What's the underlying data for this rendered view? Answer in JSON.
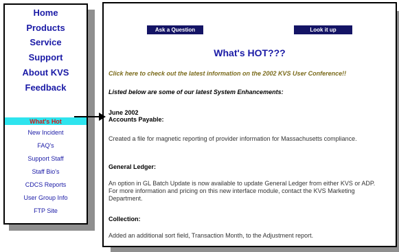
{
  "sidebar": {
    "main_items": [
      {
        "label": "Home"
      },
      {
        "label": "Products"
      },
      {
        "label": "Service"
      },
      {
        "label": "Support"
      },
      {
        "label": "About KVS"
      },
      {
        "label": "Feedback"
      }
    ],
    "sub_items": [
      {
        "label": "What's Hot"
      },
      {
        "label": "New Incident"
      },
      {
        "label": "FAQ's"
      },
      {
        "label": "Support Staff"
      },
      {
        "label": "Staff Bio's"
      },
      {
        "label": "CDCS Reports"
      },
      {
        "label": "User Group Info"
      },
      {
        "label": "FTP Site"
      }
    ]
  },
  "toolbar": {
    "ask_label": "Ask a Question",
    "lookup_label": "Look it up"
  },
  "content": {
    "title": "What's HOT???",
    "conference_link": "Click here to check out the latest information on the 2002 KVS User Conference!!",
    "intro": "Listed below are some of our latest System Enhancements:",
    "date": "June 2002",
    "sections": [
      {
        "heading": "Accounts Payable:",
        "text": "Created a file for magnetic reporting of provider information for Massachusetts compliance."
      },
      {
        "heading": "General Ledger:",
        "text": "An option in GL Batch Update is now available to update General Ledger from either KVS or ADP.  For more information and pricing on this new interface module, contact the KVS Marketing Department."
      },
      {
        "heading": "Collection:",
        "text": "Added an additional sort field, Transaction Month, to the Adjustment report."
      }
    ]
  },
  "colors": {
    "nav_text": "#1a1aa6",
    "highlight_bar": "#2ee4ee",
    "active_item": "#d11b1b",
    "button_bg": "#141465"
  }
}
